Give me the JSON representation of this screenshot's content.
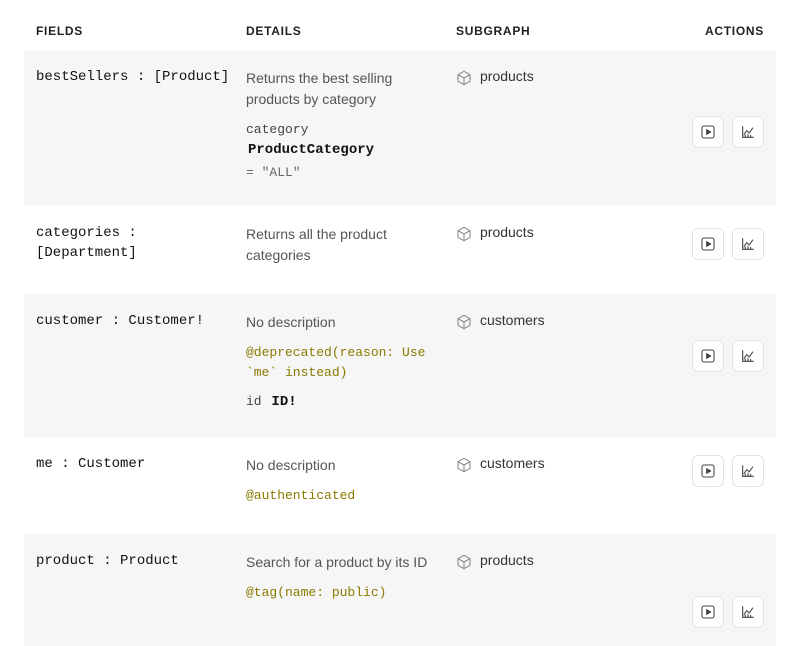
{
  "header": {
    "fields": "FIELDS",
    "details": "DETAILS",
    "subgraph": "SUBGRAPH",
    "actions": "ACTIONS"
  },
  "rows": [
    {
      "field": "bestSellers : [Product]",
      "description": "Returns the best selling products by category",
      "directive": "",
      "argName": "category",
      "argType": "ProductCategory",
      "argDefault": "= \"ALL\"",
      "subgraph": "products",
      "actionsOffset": 48
    },
    {
      "field": "categories : [Department]",
      "description": "Returns all the product categories",
      "directive": "",
      "argName": "",
      "argType": "",
      "argDefault": "",
      "subgraph": "products",
      "actionsOffset": 4
    },
    {
      "field": "customer : Customer!",
      "description": "No description",
      "directive": "@deprecated(reason: Use `me` instead)",
      "argName": "id",
      "argType": "ID!",
      "argInline": true,
      "argDefault": "",
      "subgraph": "customers",
      "actionsOffset": 28
    },
    {
      "field": "me : Customer",
      "description": "No description",
      "directive": "@authenticated",
      "argName": "",
      "argType": "",
      "argDefault": "",
      "subgraph": "customers",
      "actionsOffset": 0
    },
    {
      "field": "product : Product",
      "description": "Search for a product by its ID",
      "directive": "@tag(name: public)",
      "argName": "",
      "argType": "",
      "argDefault": "",
      "subgraph": "products",
      "actionsOffset": 44
    }
  ]
}
